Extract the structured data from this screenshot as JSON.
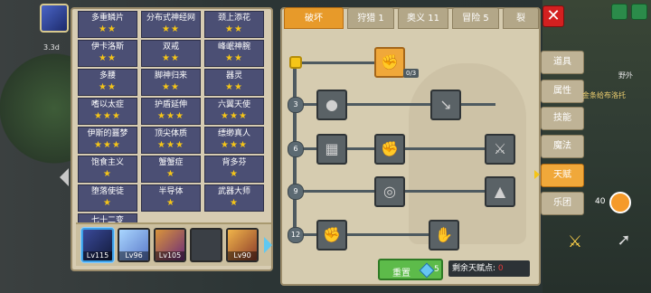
{
  "top_tabs": [
    {
      "label": "破坏",
      "active": true
    },
    {
      "label": "狩猎 1",
      "active": false
    },
    {
      "label": "奥义 11",
      "active": false
    },
    {
      "label": "冒险 5",
      "active": false
    },
    {
      "label": "裂",
      "active": false
    }
  ],
  "side_tabs": [
    {
      "label": "道具",
      "active": false
    },
    {
      "label": "属性",
      "active": false
    },
    {
      "label": "技能",
      "active": false
    },
    {
      "label": "魔法",
      "active": false
    },
    {
      "label": "天赋",
      "active": true
    },
    {
      "label": "乐团",
      "active": false
    }
  ],
  "talents": [
    {
      "name": "多重鳞片",
      "stars": "★★"
    },
    {
      "name": "分布式神经网",
      "stars": "★★"
    },
    {
      "name": "颈上添花",
      "stars": "★★"
    },
    {
      "name": "伊卡洛斯",
      "stars": "★★"
    },
    {
      "name": "双戒",
      "stars": "★★"
    },
    {
      "name": "峰岷神腕",
      "stars": "★★"
    },
    {
      "name": "多腰",
      "stars": "★★"
    },
    {
      "name": "脚神归来",
      "stars": "★★"
    },
    {
      "name": "器灵",
      "stars": "★★"
    },
    {
      "name": "嗜以太症",
      "stars": "★★★"
    },
    {
      "name": "护盾延伸",
      "stars": "★★★"
    },
    {
      "name": "六翼天使",
      "stars": "★★★"
    },
    {
      "name": "伊斯的噩梦",
      "stars": "★★★"
    },
    {
      "name": "顶尖体质",
      "stars": "★★★"
    },
    {
      "name": "缥缈真人",
      "stars": "★★★"
    },
    {
      "name": "饱食主义",
      "stars": "★"
    },
    {
      "name": "蟹蟹症",
      "stars": "★"
    },
    {
      "name": "背多芬",
      "stars": "★"
    },
    {
      "name": "堕落使徒",
      "stars": "★"
    },
    {
      "name": "半导体",
      "stars": "★"
    },
    {
      "name": "武器大师",
      "stars": "★"
    },
    {
      "name": "七十二变",
      "stars": "★"
    }
  ],
  "characters": [
    {
      "level": "Lv115",
      "selected": true
    },
    {
      "level": "Lv96",
      "selected": false
    },
    {
      "level": "Lv105",
      "selected": false
    },
    {
      "level": "",
      "selected": false
    },
    {
      "level": "Lv90",
      "selected": false
    }
  ],
  "tree": {
    "start_node_count": "0/3",
    "row_numbers": [
      "3",
      "6",
      "9",
      "12"
    ]
  },
  "reset": {
    "label": "重置",
    "cost": "5"
  },
  "remaining": {
    "label": "剩余天赋点:",
    "value": "0"
  },
  "map": {
    "label": "野外",
    "quest": "金条给布洛托"
  },
  "hud": {
    "number": "40"
  },
  "corner": {
    "text": "3.3d"
  },
  "colors": {
    "active_tab": "#e79a2a",
    "talent_cell": "#4b4f74",
    "star": "#f5c518",
    "reset": "#5dbb4a"
  }
}
